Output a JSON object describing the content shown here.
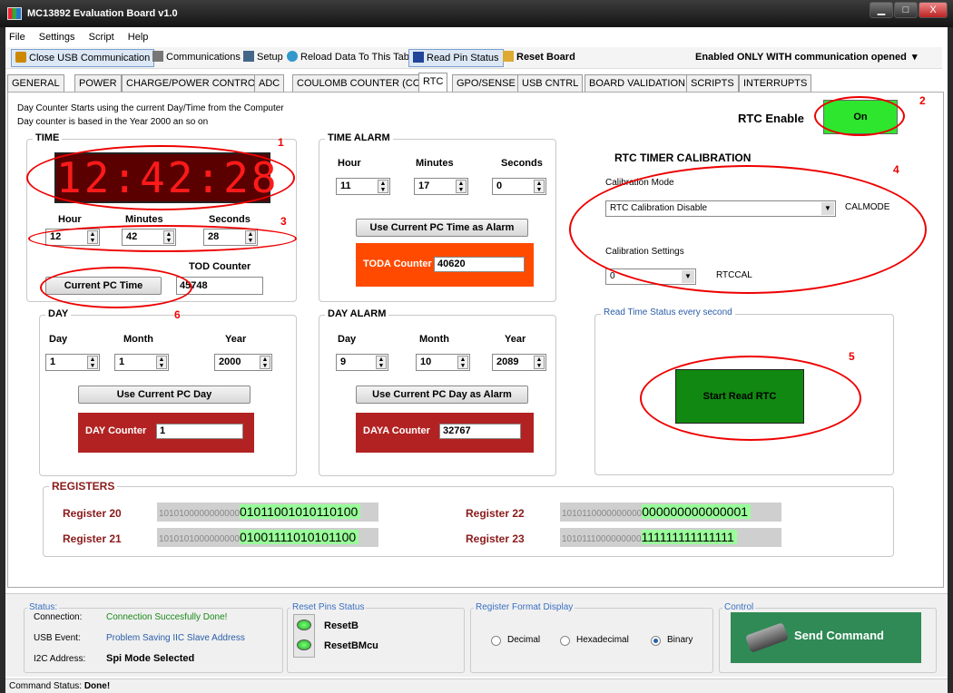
{
  "window": {
    "title": "MC13892 Evaluation Board v1.0",
    "min": "▁",
    "max": "□",
    "close": "X"
  },
  "menu": [
    "File",
    "Settings",
    "Script",
    "Help"
  ],
  "toolbar": {
    "close_usb": "Close USB Communication",
    "communications": "Communications",
    "setup": "Setup",
    "reload": "Reload Data To This Tab",
    "read_pin": "Read Pin Status",
    "reset": "Reset Board",
    "status": "Enabled ONLY WITH communication opened",
    "caret": "▾"
  },
  "tabs": [
    "GENERAL",
    "POWER",
    "CHARGE/POWER CONTROL",
    "ADC",
    "COULOMB COUNTER (CC)",
    "RTC",
    "GPO/SENSE",
    "USB CNTRL",
    "BOARD VALIDATION",
    "SCRIPTS",
    "INTERRUPTS"
  ],
  "info": {
    "line1": "Day Counter Starts using the current Day/Time from the Computer",
    "line2": "Day counter is based in the Year 2000 an so on"
  },
  "rtc_enable": {
    "label": "RTC Enable",
    "button": "On"
  },
  "time": {
    "label": "TIME",
    "display": "12:42:28",
    "hour_label": "Hour",
    "minutes_label": "Minutes",
    "seconds_label": "Seconds",
    "hour": "12",
    "minutes": "42",
    "seconds": "28",
    "button": "Current PC Time",
    "tod_label": "TOD Counter",
    "tod_value": "45748"
  },
  "time_alarm": {
    "label": "TIME ALARM",
    "hour_label": "Hour",
    "minutes_label": "Minutes",
    "seconds_label": "Seconds",
    "hour": "11",
    "minutes": "17",
    "seconds": "0",
    "button": "Use Current PC Time as Alarm",
    "counter_label": "TODA Counter",
    "counter_value": "40620"
  },
  "calibration": {
    "title": "RTC TIMER CALIBRATION",
    "mode_label": "Calibration Mode",
    "mode_value": "RTC Calibration Disable",
    "mode_tag": "CALMODE",
    "settings_label": "Calibration Settings",
    "settings_value": "0",
    "settings_tag": "RTCCAL"
  },
  "day": {
    "label": "DAY",
    "day_label": "Day",
    "month_label": "Month",
    "year_label": "Year",
    "day": "1",
    "month": "1",
    "year": "2000",
    "button": "Use Current PC Day",
    "counter_label": "DAY Counter",
    "counter_value": "1"
  },
  "day_alarm": {
    "label": "DAY ALARM",
    "day_label": "Day",
    "month_label": "Month",
    "year_label": "Year",
    "day": "9",
    "month": "10",
    "year": "2089",
    "button": "Use Current PC Day as Alarm",
    "counter_label": "DAYA Counter",
    "counter_value": "32767"
  },
  "read_status": {
    "label": "Read Time Status every second",
    "button": "Start Read RTC"
  },
  "registers": {
    "label": "REGISTERS",
    "items": [
      {
        "name": "Register 20",
        "prefix": "1010100000000000",
        "bits": "01011001010110100"
      },
      {
        "name": "Register 21",
        "prefix": "1010101000000000",
        "bits": "01001111010101100"
      },
      {
        "name": "Register 22",
        "prefix": "1010110000000000",
        "bits": "000000000000001"
      },
      {
        "name": "Register 23",
        "prefix": "1010111000000000",
        "bits": "111111111111111"
      }
    ]
  },
  "annotations": [
    "1",
    "2",
    "3",
    "4",
    "5",
    "6"
  ],
  "status": {
    "title": "Status:",
    "connection_label": "Connection:",
    "connection_value": "Connection Succesfully Done!",
    "usb_label": "USB Event:",
    "usb_value": "Problem Saving IIC Slave Address",
    "i2c_label": "I2C Address:",
    "i2c_value": "Spi Mode Selected"
  },
  "reset_pins": {
    "title": "Reset Pins Status",
    "reset_b": "ResetB",
    "reset_bmcu": "ResetBMcu"
  },
  "format": {
    "title": "Register Format Display",
    "decimal": "Decimal",
    "hex": "Hexadecimal",
    "binary": "Binary",
    "selected": "Binary"
  },
  "control": {
    "title": "Control",
    "send": "Send Command"
  },
  "command_status": {
    "label": "Command Status:",
    "value": "Done!"
  },
  "colors": {
    "seg_red": "#ff1a1a",
    "counter_red": "#b22222",
    "toda_orange": "#ff4a00",
    "green": "#2ecc2e",
    "start_green": "#118811"
  }
}
